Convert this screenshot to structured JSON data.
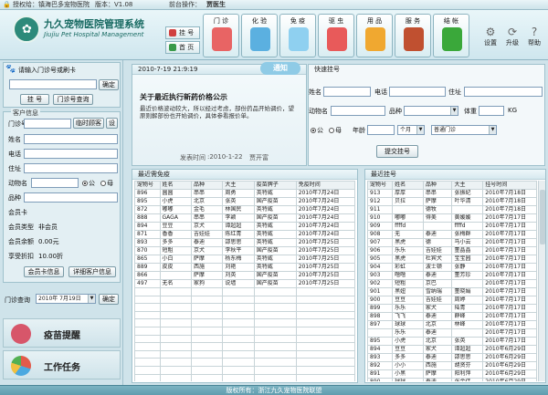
{
  "topbar": {
    "license": "授权给：镇海巴多宠物医院",
    "version": "版本：V1.08",
    "operator_label": "前台操作：",
    "operator": "贾医生"
  },
  "header": {
    "title_cn": "九久宠物医院管理系统",
    "title_en": "Jiujiu Pet Hospital Management",
    "small_nav": [
      "挂 号",
      "首 页"
    ],
    "nav": [
      {
        "label": "门 诊",
        "icon": "clinic-icon",
        "color": "#e86464"
      },
      {
        "label": "化 验",
        "icon": "lab-icon",
        "color": "#5bb0e0"
      },
      {
        "label": "免 疫",
        "icon": "vaccine-icon",
        "color": "#8fd0f0"
      },
      {
        "label": "驱 虫",
        "icon": "deworm-icon",
        "color": "#e85a5a"
      },
      {
        "label": "用 品",
        "icon": "supplies-icon",
        "color": "#f0a830"
      },
      {
        "label": "服 务",
        "icon": "service-icon",
        "color": "#c05030"
      },
      {
        "label": "结 帐",
        "icon": "checkout-icon",
        "color": "#3aa83a"
      }
    ],
    "tools": [
      {
        "label": "设置",
        "icon": "gear-icon"
      },
      {
        "label": "升级",
        "icon": "upgrade-icon"
      },
      {
        "label": "帮助",
        "icon": "help-icon"
      }
    ]
  },
  "left": {
    "card_prompt": "请输入门诊号或刷卡",
    "confirm": "确定",
    "register_btn": "挂 号",
    "clinic_query_btn": "门诊号查询",
    "customer_info": "客户信息",
    "fields": {
      "clinic_no": "门诊号",
      "temp_customer": "临时顾客",
      "set": "设",
      "name": "姓名",
      "phone": "电话",
      "address": "住址",
      "pet_name": "动物名",
      "male": "公",
      "female": "母",
      "breed": "品种",
      "member_card": "会员卡",
      "member_type_label": "会员类型",
      "member_type": "非会员",
      "member_balance_label": "会员余额",
      "member_balance": "0.00元",
      "discount_label": "享受折扣",
      "discount": "10.00折"
    },
    "member_info_btn": "会员卡信息",
    "detail_query_btn": "详细客户信息",
    "clinic_query_label": "门诊查询",
    "clinic_query_date": "2010年 7月19日",
    "clinic_query_ok": "确定",
    "vaccine_reminder": "疫苗提醒",
    "work_tasks": "工作任务"
  },
  "notice": {
    "datetime": "2010-7-19 21:9:19",
    "badge": "通知",
    "title": "关于最近执行新药价格公示",
    "body": "最近价格波动较大，所以经过考虑，部份药品开始调价，望原则解部份也开始调价，具体参看报价单。",
    "posted_label": "发表时间",
    "posted_date": ":2010-1-22",
    "author": "贾开富"
  },
  "quick": {
    "title": "快速挂号",
    "name": "姓名",
    "phone": "电话",
    "address": "住址",
    "pet_name": "动物名",
    "breed": "品种",
    "weight": "体重",
    "weight_unit": "KG",
    "male": "公",
    "female": "母",
    "age": "年龄",
    "month": "个月",
    "clinic_type": "普通门诊",
    "submit": "提交挂号"
  },
  "vaccine_table": {
    "title": "最近需免疫",
    "headers": [
      "宠物号",
      "姓名",
      "品种",
      "大主",
      "疫苗牌子",
      "免疫时间"
    ],
    "rows": [
      [
        "896",
        "圆圆",
        "串串",
        "周勇",
        "英特威",
        "2010年7月24日"
      ],
      [
        "895",
        "小虎",
        "北京",
        "张英",
        "国产疫苗",
        "2010年7月24日"
      ],
      [
        "872",
        "嘟嘟",
        "金毛",
        "林国民",
        "英特威",
        "2010年7月24日"
      ],
      [
        "888",
        "GAGA",
        "串串",
        "李颖",
        "国产疫苗",
        "2010年7月24日"
      ],
      [
        "894",
        "豆豆",
        "京犬",
        "谭超超",
        "英特威",
        "2010年7月24日"
      ],
      [
        "871",
        "香香",
        "吉娃娃",
        "陈红青",
        "英特威",
        "2010年7月24日"
      ],
      [
        "893",
        "多多",
        "泰迪",
        "邵思思",
        "英特威",
        "2010年7月25日"
      ],
      [
        "870",
        "短粗",
        "京犬",
        "李秋平",
        "国产疫苗",
        "2010年7月25日"
      ],
      [
        "865",
        "小白",
        "萨摩",
        "杨东梅",
        "英特威",
        "2010年7月25日"
      ],
      [
        "889",
        "皮皮",
        "西施",
        "刘艳",
        "英特威",
        "2010年7月25日"
      ],
      [
        "866",
        "",
        "萨摩",
        "刘英",
        "国产疫苗",
        "2010年7月25日"
      ],
      [
        "497",
        "无名",
        "家狗",
        "说墙",
        "国产疫苗",
        "2010年7月25日"
      ]
    ]
  },
  "reg_table": {
    "title": "最近挂号",
    "headers": [
      "宠物号",
      "姓名",
      "品种",
      "大主",
      "挂号时间"
    ],
    "rows": [
      [
        "913",
        "厚厚",
        "串串",
        "张振纪",
        "2010年7月18日"
      ],
      [
        "912",
        "贝拉",
        "萨摩",
        "叶华清",
        "2010年7月18日"
      ],
      [
        "911",
        "",
        "德牧",
        "",
        "2010年7月18日"
      ],
      [
        "910",
        "嘟嘟",
        "得美",
        "黄媛媛",
        "2010年7月17日"
      ],
      [
        "909",
        "ffffd",
        "",
        "ffffd",
        "2010年7月17日"
      ],
      [
        "908",
        "无",
        "泰迪",
        "张梅群",
        "2010年7月17日"
      ],
      [
        "907",
        "黑虎",
        "德",
        "马小云",
        "2010年7月17日"
      ],
      [
        "906",
        "乐乐",
        "吉娃娃",
        "董晶晶",
        "2010年7月17日"
      ],
      [
        "905",
        "黑虎",
        "杜宾犬",
        "宝宝园",
        "2010年7月17日"
      ],
      [
        "904",
        "彩虹",
        "波士顿",
        "张静",
        "2010年7月17日"
      ],
      [
        "903",
        "噜噜",
        "泰迪",
        "董芳珍",
        "2010年7月17日"
      ],
      [
        "902",
        "短粗",
        "京巴",
        "",
        "2010年7月17日"
      ],
      [
        "901",
        "黑妞",
        "雪纳瑞",
        "董晓娟",
        "2010年7月17日"
      ],
      [
        "900",
        "豆豆",
        "吉娃娃",
        "周婷",
        "2010年7月17日"
      ],
      [
        "899",
        "乐乐",
        "家犬",
        "陆青",
        "2010年7月17日"
      ],
      [
        "898",
        "飞飞",
        "泰迪",
        "薛峰",
        "2010年7月17日"
      ],
      [
        "897",
        "球球",
        "北京",
        "林峰",
        "2010年7月17日"
      ],
      [
        "",
        "乐乐",
        "泰迪",
        "",
        "2010年7月17日"
      ],
      [
        "895",
        "小虎",
        "北京",
        "张英",
        "2010年7月17日"
      ],
      [
        "894",
        "豆豆",
        "家犬",
        "谭超超",
        "2010年6月29日"
      ],
      [
        "893",
        "多多",
        "泰迪",
        "邵思思",
        "2010年6月29日"
      ],
      [
        "892",
        "小小",
        "西施",
        "胡贤芬",
        "2010年6月29日"
      ],
      [
        "891",
        "小黑",
        "萨摩",
        "阳利萍",
        "2010年6月29日"
      ],
      [
        "890",
        "球球",
        "泰迪",
        "张金伟",
        "2010年6月29日"
      ]
    ]
  },
  "footer": "版权所有：浙江九久宠物医院联盟"
}
